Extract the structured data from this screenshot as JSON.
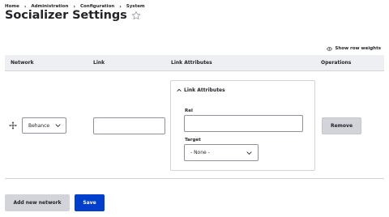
{
  "breadcrumb": {
    "items": [
      "Home",
      "Administration",
      "Configuration",
      "System"
    ],
    "separator": "›"
  },
  "page": {
    "title": "Socializer Settings",
    "star_icon": "star-outline-icon"
  },
  "toolbar": {
    "row_weights_label": "Show row weights",
    "row_weights_icon": "eye-icon"
  },
  "table": {
    "headers": [
      "Network",
      "Link",
      "Link Attributes",
      "Operations"
    ],
    "rows": [
      {
        "network_value": "Behance",
        "link_value": "",
        "link_attributes": {
          "summary_label": "Link Attributes",
          "rel_label": "Rel",
          "rel_value": "",
          "target_label": "Target",
          "target_value": "- None -"
        },
        "remove_label": "Remove"
      }
    ]
  },
  "actions": {
    "add_label": "Add new network",
    "save_label": "Save"
  },
  "colors": {
    "primary": "#003ecc",
    "header_bg": "#eeeff2",
    "button_gray": "#d3d4d9",
    "text": "#232429"
  }
}
